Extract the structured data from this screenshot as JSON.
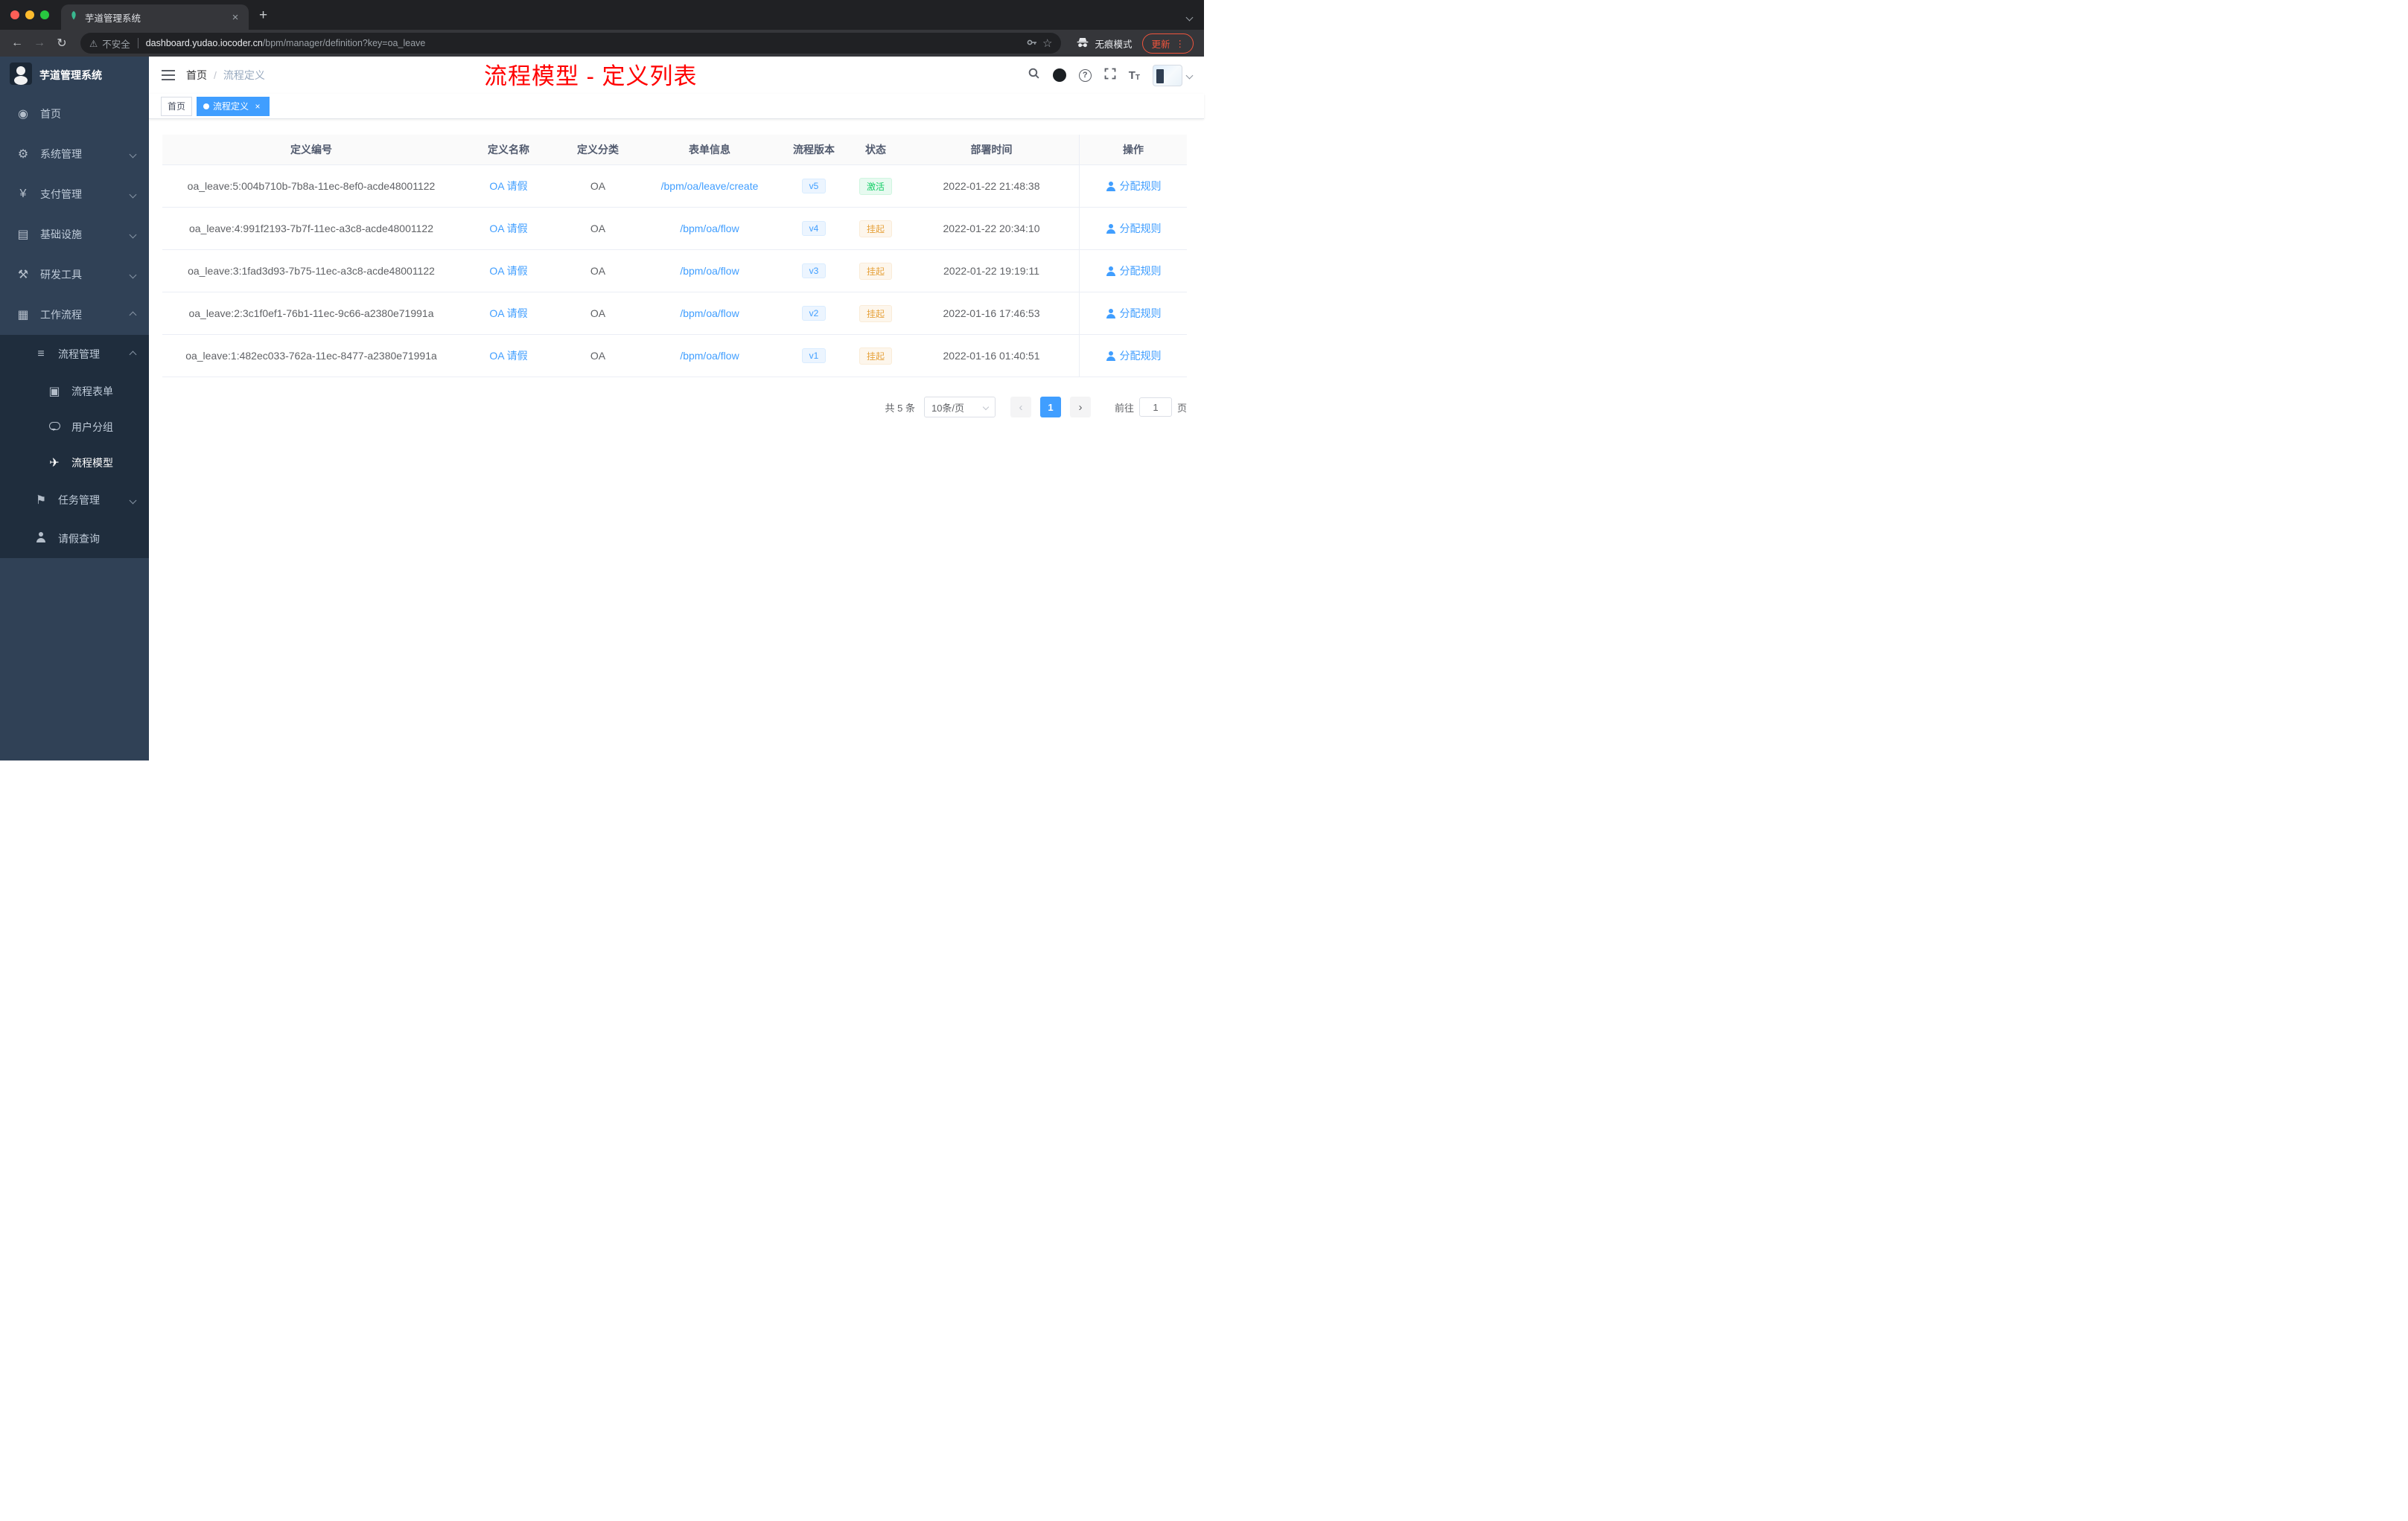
{
  "browser": {
    "tab_title": "芋道管理系统",
    "close_glyph": "×",
    "new_tab_glyph": "+",
    "back_glyph": "←",
    "forward_glyph": "→",
    "reload_glyph": "↻",
    "warning_glyph": "⚠",
    "security_label": "不安全",
    "url_domain": "dashboard.yudao.iocoder.cn",
    "url_path": "/bpm/manager/definition?key=oa_leave",
    "star_glyph": "☆",
    "incognito_label": "无痕模式",
    "update_label": "更新",
    "menu_glyph": "⋮"
  },
  "sidebar": {
    "logo_title": "芋道管理系统",
    "items": [
      {
        "label": "首页"
      },
      {
        "label": "系统管理"
      },
      {
        "label": "支付管理"
      },
      {
        "label": "基础设施"
      },
      {
        "label": "研发工具"
      },
      {
        "label": "工作流程"
      }
    ],
    "process_management": "流程管理",
    "process_children": [
      {
        "label": "流程表单"
      },
      {
        "label": "用户分组"
      },
      {
        "label": "流程模型"
      }
    ],
    "task_management": "任务管理",
    "leave_query": "请假查询"
  },
  "header": {
    "breadcrumb_home": "首页",
    "breadcrumb_sep": "/",
    "breadcrumb_current": "流程定义",
    "annotation": "流程模型 - 定义列表"
  },
  "icons": {
    "dashboard": "◉",
    "gear": "⚙",
    "yen": "¥",
    "infrastructure": "▤",
    "tools": "⚒",
    "workflow": "▦",
    "process_list": "≡",
    "form": "▣",
    "send": "✈",
    "flag": "⚑",
    "question": "?",
    "font_large": "T",
    "font_small": "T"
  },
  "tags": {
    "home": "首页",
    "current": "流程定义",
    "close_glyph": "×"
  },
  "table": {
    "columns": [
      "定义编号",
      "定义名称",
      "定义分类",
      "表单信息",
      "流程版本",
      "状态",
      "部署时间",
      "操作"
    ],
    "rows": [
      {
        "id": "oa_leave:5:004b710b-7b8a-11ec-8ef0-acde48001122",
        "name": "OA 请假",
        "category": "OA",
        "form": "/bpm/oa/leave/create",
        "version": "v5",
        "status": "激活",
        "status_type": "success",
        "time": "2022-01-22 21:48:38",
        "action": "分配规则"
      },
      {
        "id": "oa_leave:4:991f2193-7b7f-11ec-a3c8-acde48001122",
        "name": "OA 请假",
        "category": "OA",
        "form": "/bpm/oa/flow",
        "version": "v4",
        "status": "挂起",
        "status_type": "warning",
        "time": "2022-01-22 20:34:10",
        "action": "分配规则"
      },
      {
        "id": "oa_leave:3:1fad3d93-7b75-11ec-a3c8-acde48001122",
        "name": "OA 请假",
        "category": "OA",
        "form": "/bpm/oa/flow",
        "version": "v3",
        "status": "挂起",
        "status_type": "warning",
        "time": "2022-01-22 19:19:11",
        "action": "分配规则"
      },
      {
        "id": "oa_leave:2:3c1f0ef1-76b1-11ec-9c66-a2380e71991a",
        "name": "OA 请假",
        "category": "OA",
        "form": "/bpm/oa/flow",
        "version": "v2",
        "status": "挂起",
        "status_type": "warning",
        "time": "2022-01-16 17:46:53",
        "action": "分配规则"
      },
      {
        "id": "oa_leave:1:482ec033-762a-11ec-8477-a2380e71991a",
        "name": "OA 请假",
        "category": "OA",
        "form": "/bpm/oa/flow",
        "version": "v1",
        "status": "挂起",
        "status_type": "warning",
        "time": "2022-01-16 01:40:51",
        "action": "分配规则"
      }
    ]
  },
  "pagination": {
    "total": "共 5 条",
    "page_size": "10条/页",
    "prev_glyph": "‹",
    "page": "1",
    "next_glyph": "›",
    "goto_label": "前往",
    "goto_value": "1",
    "goto_unit": "页"
  },
  "colors": {
    "accent": "#409eff",
    "sidebar_bg": "#304156",
    "submenu_bg": "#1f2d3d",
    "annotation": "#ff0000",
    "success": "#13ce66",
    "warning": "#e6a23c",
    "update_accent": "#f0543c"
  }
}
